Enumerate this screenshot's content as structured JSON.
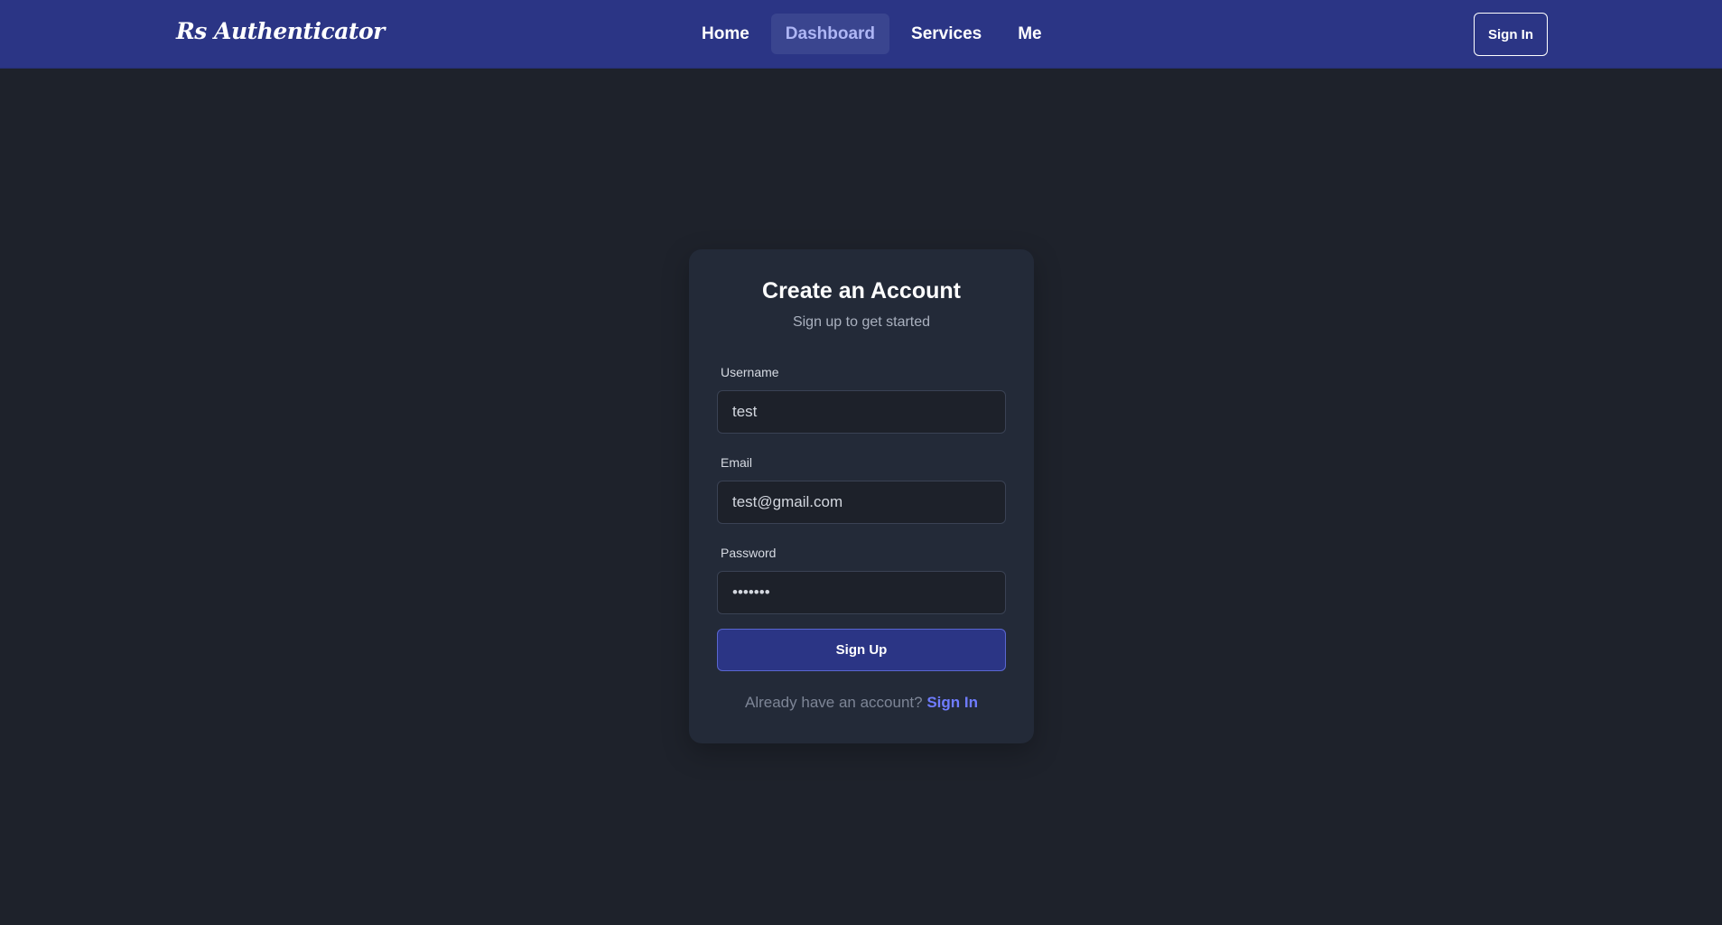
{
  "navbar": {
    "brand": "Rs Authenticator",
    "links": [
      {
        "label": "Home"
      },
      {
        "label": "Dashboard",
        "active": true
      },
      {
        "label": "Services"
      },
      {
        "label": "Me"
      }
    ],
    "signin_label": "Sign In"
  },
  "form": {
    "title": "Create an Account",
    "subtitle": "Sign up to get started",
    "username": {
      "label": "Username",
      "value": "test"
    },
    "email": {
      "label": "Email",
      "value": "test@gmail.com"
    },
    "password": {
      "label": "Password",
      "value": "•••••••"
    },
    "submit_label": "Sign Up",
    "footer_text": "Already have an account?",
    "footer_link": "Sign In"
  },
  "colors": {
    "navbar_bg": "#2b3585",
    "page_bg": "#1e222b",
    "card_bg": "#232a38",
    "accent_link": "#6f7cff",
    "active_nav_text": "#aeb6f5"
  }
}
